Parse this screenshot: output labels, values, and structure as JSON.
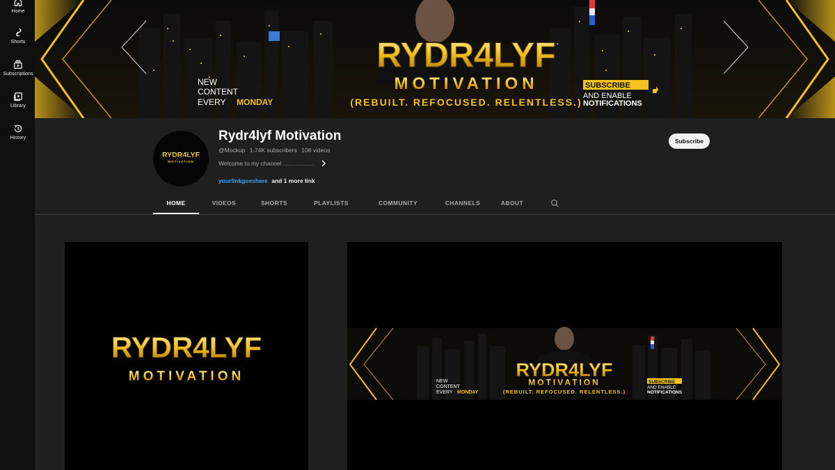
{
  "sidebar": {
    "items": [
      {
        "label": "Home",
        "icon": "home-icon"
      },
      {
        "label": "Shorts",
        "icon": "shorts-icon"
      },
      {
        "label": "Subscriptions",
        "icon": "subscriptions-icon"
      },
      {
        "label": "Library",
        "icon": "library-icon"
      },
      {
        "label": "History",
        "icon": "history-icon"
      }
    ]
  },
  "banner": {
    "brand_name": "RYDR4LYF",
    "brand_sub": "MOTIVATION",
    "tagline": "(REBUILT. REFOCUSED. RELENTLESS.)",
    "new_line1": "NEW",
    "new_line2": "CONTENT",
    "new_line3": "EVERY",
    "new_day": "MONDAY",
    "subscribe_tag": "SUBSCRIBE",
    "notif_line1": "AND ENABLE",
    "notif_line2": "NOTIFICATIONS"
  },
  "channel": {
    "avatar_brand": "RYDR4LYF",
    "avatar_sub": "MOTIVATION",
    "title": "Rydr4lyf Motivation",
    "handle": "@Mockup",
    "subscribers": "1.74K subscribers",
    "videos": "108 videos",
    "description": "Welcome to my channel",
    "description_dots": "..................",
    "link": "yourlinkgoeshere",
    "more_links": "and 1 more link",
    "subscribe_label": "Subscribe"
  },
  "tabs": [
    {
      "label": "HOME",
      "active": true
    },
    {
      "label": "VIDEOS",
      "active": false
    },
    {
      "label": "SHORTS",
      "active": false
    },
    {
      "label": "PLAYLISTS",
      "active": false
    },
    {
      "label": "COMMUNITY",
      "active": false
    },
    {
      "label": "CHANNELS",
      "active": false
    },
    {
      "label": "ABOUT",
      "active": false
    }
  ],
  "preview_logo": {
    "brand": "RYDR4LYF",
    "sub": "MOTIVATION"
  },
  "colors": {
    "gold": "#f4c21f",
    "gold_dark": "#b07d0a",
    "link_blue": "#3ea6ff",
    "bg": "#1f1f1f"
  }
}
